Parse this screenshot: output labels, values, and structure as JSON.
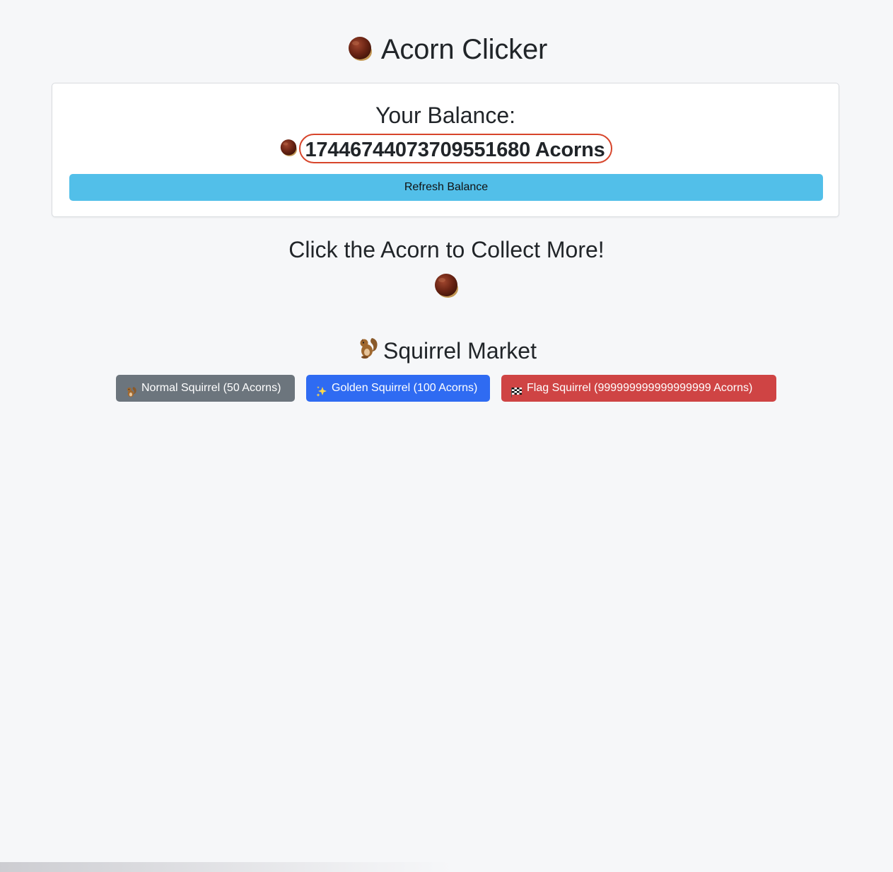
{
  "app": {
    "title": "Acorn Clicker",
    "title_icon": "acorn-icon"
  },
  "balance": {
    "heading": "Your Balance:",
    "icon": "acorn-icon",
    "value_text": "17446744073709551680 Acorns",
    "refresh_label": "Refresh Balance"
  },
  "collect": {
    "heading": "Click the Acorn to Collect More!",
    "icon": "acorn-icon"
  },
  "market": {
    "heading": "Squirrel Market",
    "heading_icon": "squirrel-icon",
    "items": [
      {
        "label": "Normal Squirrel (50 Acorns)",
        "icon": "squirrel-icon",
        "color": "#6c757d"
      },
      {
        "label": "Golden Squirrel (100 Acorns)",
        "icon": "sparkles-icon",
        "color": "#2f6bf2"
      },
      {
        "label": "Flag Squirrel (999999999999999999 Acorns)",
        "icon": "checkered-flag-icon",
        "color": "#cf4444"
      }
    ]
  },
  "colors": {
    "background": "#f6f7f9",
    "refresh_button": "#52bfe9",
    "balance_highlight": "#d7452b"
  }
}
